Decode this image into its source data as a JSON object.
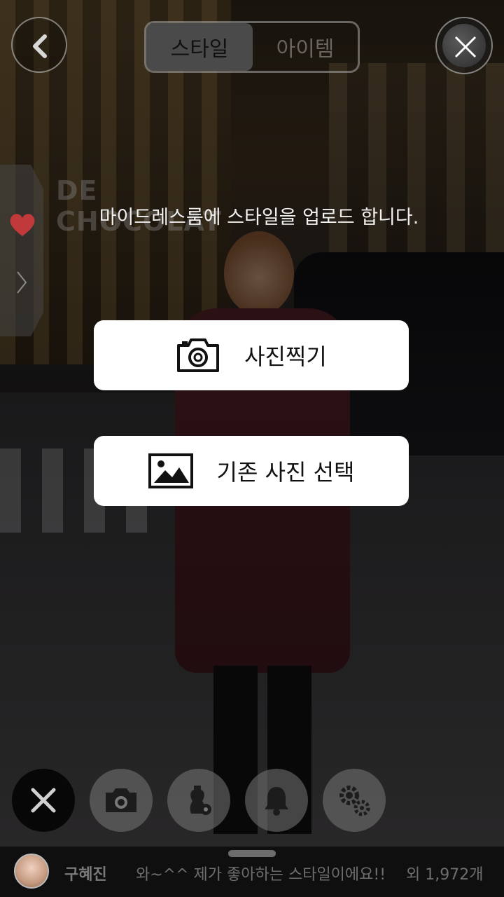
{
  "header": {
    "tabs": [
      {
        "label": "스타일",
        "active": true
      },
      {
        "label": "아이템",
        "active": false
      }
    ]
  },
  "prompt": "마이드레스룸에 스타일을 업로드 합니다.",
  "actions": {
    "take_photo": {
      "label": "사진찍기",
      "icon": "camera-icon"
    },
    "choose_photo": {
      "label": "기존 사진 선택",
      "icon": "image-icon"
    }
  },
  "background_sign_text": "DE CHOCOLAT",
  "toolbar": {
    "items": [
      "close-icon",
      "camera-icon",
      "dress-settings-icon",
      "bell-icon",
      "gear-icon"
    ]
  },
  "feed": {
    "username": "구혜진",
    "message": "와~^^ 제가 좋아하는 스타일이에요!!",
    "count": "외 1,972개"
  },
  "colors": {
    "heart": "#c0393b",
    "button_bg": "#ffffff",
    "overlay": "rgba(0,0,0,0.42)"
  }
}
